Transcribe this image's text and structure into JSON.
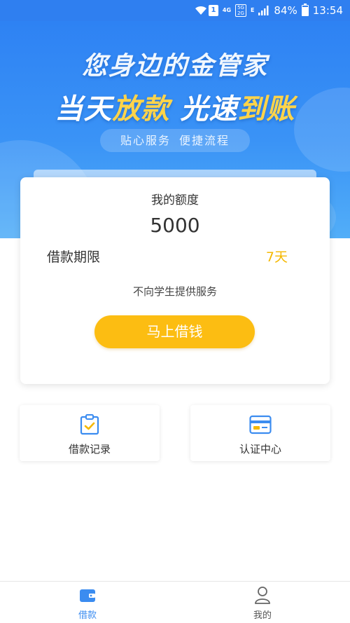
{
  "status_bar": {
    "network_4g": "4G",
    "network_box_top": "5G",
    "network_box_bottom": "2G",
    "network_e": "E",
    "sim_slot": "1",
    "battery": "84%",
    "time": "13:54",
    "icons": [
      "wifi-icon",
      "signal-icon",
      "battery-icon"
    ]
  },
  "hero": {
    "title": "您身边的金管家",
    "slogan_part1": "当天",
    "slogan_part2": "放款",
    "slogan_part3": "光速",
    "slogan_part4": "到账",
    "pill_left": "贴心服务",
    "pill_right": "便捷流程"
  },
  "card": {
    "quota_label": "我的额度",
    "quota_value": "5000",
    "term_label": "借款期限",
    "term_value": "7天",
    "notice": "不向学生提供服务",
    "borrow_button": "马上借钱"
  },
  "tiles": {
    "records": {
      "label": "借款记录",
      "icon": "clipboard-check-icon"
    },
    "verify": {
      "label": "认证中心",
      "icon": "id-card-icon"
    }
  },
  "tabbar": {
    "home": {
      "label": "借款",
      "icon": "wallet-icon"
    },
    "me": {
      "label": "我的",
      "icon": "person-icon"
    }
  },
  "colors": {
    "primary_blue": "#2f7ff0",
    "accent_yellow": "#fcbd12",
    "term_yellow": "#f5b800"
  }
}
